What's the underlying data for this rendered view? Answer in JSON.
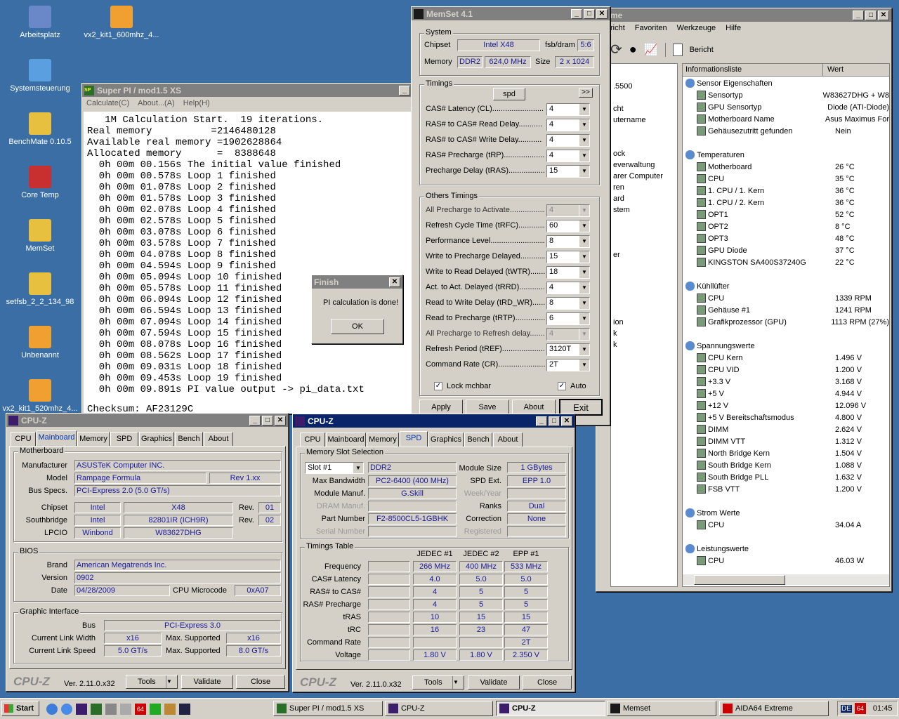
{
  "desktop": {
    "icons": [
      "Arbeitsplatz",
      "vx2_kit1_600mhz_4...",
      "Systemsteuerung",
      "BenchMate 0.10.5",
      "Core Temp",
      "MemSet",
      "setfsb_2_2_134_98",
      "Unbenannt",
      "vx2_kit1_520mhz_4..."
    ]
  },
  "aida": {
    "title_fragment": "me",
    "menu": [
      "richt",
      "Favoriten",
      "Werkzeuge",
      "Hilfe"
    ],
    "toolbar_report": "Bericht",
    "col_info": "Informationsliste",
    "col_value": "Wert",
    "tree_fragments": [
      ".5500",
      "cht",
      "utername",
      "ock",
      "everwaltung",
      "arer Computer",
      "ren",
      "ard",
      "stem",
      "er",
      "ion",
      "k",
      "k"
    ],
    "sections": [
      {
        "title": "Sensor Eigenschaften",
        "rows": [
          [
            "Sensortyp",
            "W83627DHG + W8"
          ],
          [
            "GPU Sensortyp",
            "Diode  (ATI-Diode)"
          ],
          [
            "Motherboard Name",
            "Asus Maximus For"
          ],
          [
            "Gehäusezutritt gefunden",
            "Nein"
          ]
        ]
      },
      {
        "title": "Temperaturen",
        "rows": [
          [
            "Motherboard",
            "26 °C"
          ],
          [
            "CPU",
            "35 °C"
          ],
          [
            "1. CPU / 1. Kern",
            "36 °C"
          ],
          [
            "1. CPU / 2. Kern",
            "36 °C"
          ],
          [
            "OPT1",
            "52 °C"
          ],
          [
            "OPT2",
            "8 °C"
          ],
          [
            "OPT3",
            "48 °C"
          ],
          [
            "GPU Diode",
            "37 °C"
          ],
          [
            "KINGSTON SA400S37240G",
            "22 °C"
          ]
        ]
      },
      {
        "title": "Kühllüfter",
        "rows": [
          [
            "CPU",
            "1339 RPM"
          ],
          [
            "Gehäuse #1",
            "1241 RPM"
          ],
          [
            "Grafikprozessor (GPU)",
            "1113 RPM  (27%)"
          ]
        ]
      },
      {
        "title": "Spannungswerte",
        "rows": [
          [
            "CPU Kern",
            "1.496 V"
          ],
          [
            "CPU VID",
            "1.200 V"
          ],
          [
            "+3.3 V",
            "3.168 V"
          ],
          [
            "+5 V",
            "4.944 V"
          ],
          [
            "+12 V",
            "12.096 V"
          ],
          [
            "+5 V Bereitschaftsmodus",
            "4.800 V"
          ],
          [
            "DIMM",
            "2.624 V"
          ],
          [
            "DIMM VTT",
            "1.312 V"
          ],
          [
            "North Bridge Kern",
            "1.504 V"
          ],
          [
            "South Bridge Kern",
            "1.088 V"
          ],
          [
            "South Bridge PLL",
            "1.632 V"
          ],
          [
            "FSB VTT",
            "1.200 V"
          ]
        ]
      },
      {
        "title": "Strom Werte",
        "rows": [
          [
            "CPU",
            "34.04 A"
          ]
        ]
      },
      {
        "title": "Leistungswerte",
        "rows": [
          [
            "CPU",
            "46.03 W"
          ]
        ]
      }
    ]
  },
  "memset": {
    "title": "MemSet 4.1",
    "system": "System",
    "chipset_l": "Chipset",
    "chipset": "Intel  X48",
    "fsb_l": "fsb/dram",
    "fsb": "5:6",
    "memory_l": "Memory",
    "mem_type": "DDR2",
    "mem_freq": "624,0 MHz",
    "size_l": "Size",
    "size": "2 x 1024",
    "timings": "Timings",
    "spd": "spd",
    "more": ">>",
    "t_rows": [
      [
        "CAS# Latency (CL)........................",
        "4"
      ],
      [
        "RAS# to CAS# Read Delay...........",
        "4"
      ],
      [
        "RAS# to CAS# Write Delay...........",
        "4"
      ],
      [
        "RAS# Precharge (tRP)....................",
        "4"
      ],
      [
        "Precharge Delay  (tRAS)...................",
        "15"
      ]
    ],
    "others": "Others Timings",
    "o_rows": [
      [
        "All Precharge to Activate...................",
        "4"
      ],
      [
        "Refresh Cycle Time (tRFC)...............",
        "60"
      ],
      [
        "Performance Level.............................",
        "8"
      ],
      [
        "Write to Precharge Delayed...............",
        "15"
      ],
      [
        "Write to Read Delayed (tWTR)...........",
        "18"
      ],
      [
        "Act. to Act. Delayed (tRRD)...............",
        "4"
      ],
      [
        "Read to Write Delay (tRD_WR)..........",
        "8"
      ],
      [
        "Read to Precharge (tRTP)................",
        "6"
      ],
      [
        "All Precharge to Refresh delay..........",
        "4"
      ],
      [
        "Refresh Period (tREF)........................",
        "3120T"
      ],
      [
        "Command Rate (CR)...........................",
        "2T"
      ]
    ],
    "lock": "Lock mchbar",
    "auto": "Auto",
    "apply": "Apply",
    "save": "Save",
    "about": "About",
    "exit": "Exit"
  },
  "superpi": {
    "title": "Super PI / mod1.5 XS",
    "menu": [
      "Calculate(C)",
      "About...(A)",
      "Help(H)"
    ],
    "lines": [
      "   1M Calculation Start.  19 iterations.",
      "Real memory          =2146480128",
      "Available real memory =1902628864",
      "Allocated memory      =  8388648",
      "  0h 00m 00.156s The initial value finished",
      "  0h 00m 00.578s Loop 1 finished",
      "  0h 00m 01.078s Loop 2 finished",
      "  0h 00m 01.578s Loop 3 finished",
      "  0h 00m 02.078s Loop 4 finished",
      "  0h 00m 02.578s Loop 5 finished",
      "  0h 00m 03.078s Loop 6 finished",
      "  0h 00m 03.578s Loop 7 finished",
      "  0h 00m 04.078s Loop 8 finished",
      "  0h 00m 04.594s Loop 9 finished",
      "  0h 00m 05.094s Loop 10 finished",
      "  0h 00m 05.578s Loop 11 finished",
      "  0h 00m 06.094s Loop 12 finished",
      "  0h 00m 06.594s Loop 13 finished",
      "  0h 00m 07.094s Loop 14 finished",
      "  0h 00m 07.594s Loop 15 finished",
      "  0h 00m 08.078s Loop 16 finished",
      "  0h 00m 08.562s Loop 17 finished",
      "  0h 00m 09.031s Loop 18 finished",
      "  0h 00m 09.453s Loop 19 finished",
      "  0h 00m 09.891s PI value output -> pi_data.txt"
    ],
    "checksum": "Checksum: AF23129C"
  },
  "finish": {
    "title": "Finish",
    "msg": "PI calculation is done!",
    "ok": "OK"
  },
  "cpuz1": {
    "title": "CPU-Z",
    "tabs": [
      "CPU",
      "Mainboard",
      "Memory",
      "SPD",
      "Graphics",
      "Bench",
      "About"
    ],
    "active": "Mainboard",
    "motherboard": "Motherboard",
    "manufacturer_l": "Manufacturer",
    "manufacturer": "ASUSTeK Computer INC.",
    "model_l": "Model",
    "model": "Rampage Formula",
    "rev": "Rev 1.xx",
    "bus_l": "Bus Specs.",
    "bus": "PCI-Express 2.0 (5.0 GT/s)",
    "chipset_l": "Chipset",
    "chipset_v": "Intel",
    "chipset_m": "X48",
    "rev_l": "Rev.",
    "chipset_rev": "01",
    "sb_l": "Southbridge",
    "sb_v": "Intel",
    "sb_m": "82801IR (ICH9R)",
    "sb_rev": "02",
    "lpcio_l": "LPCIO",
    "lpcio_v": "Winbond",
    "lpcio_m": "W83627DHG",
    "bios": "BIOS",
    "brand_l": "Brand",
    "brand": "American Megatrends Inc.",
    "version_l": "Version",
    "version": "0902",
    "date_l": "Date",
    "date": "04/28/2009",
    "micro_l": "CPU Microcode",
    "micro": "0xA07",
    "gi": "Graphic Interface",
    "gbus_l": "Bus",
    "gbus": "PCI-Express 3.0",
    "clw_l": "Current Link Width",
    "clw": "x16",
    "ms_l": "Max. Supported",
    "mlw": "x16",
    "cls_l": "Current Link Speed",
    "cls": "5.0 GT/s",
    "mls": "8.0 GT/s",
    "brand_logo": "CPU-Z",
    "ver": "Ver. 2.11.0.x32",
    "tools": "Tools",
    "validate": "Validate",
    "close": "Close"
  },
  "cpuz2": {
    "title": "CPU-Z",
    "tabs": [
      "CPU",
      "Mainboard",
      "Memory",
      "SPD",
      "Graphics",
      "Bench",
      "About"
    ],
    "active": "SPD",
    "mss": "Memory Slot Selection",
    "slot": "Slot #1",
    "type": "DDR2",
    "modsize_l": "Module Size",
    "modsize": "1 GBytes",
    "maxbw_l": "Max Bandwidth",
    "maxbw": "PC2-6400 (400 MHz)",
    "spdext_l": "SPD Ext.",
    "spdext": "EPP 1.0",
    "modman_l": "Module Manuf.",
    "modman": "G.Skill",
    "week_l": "Week/Year",
    "dram_l": "DRAM Manuf.",
    "ranks_l": "Ranks",
    "ranks": "Dual",
    "part_l": "Part Number",
    "part": "F2-8500CL5-1GBHK",
    "corr_l": "Correction",
    "corr": "None",
    "serial_l": "Serial Number",
    "reg_l": "Registered",
    "tt": "Timings Table",
    "cols": [
      "JEDEC #1",
      "JEDEC #2",
      "EPP #1"
    ],
    "rows": [
      [
        "Frequency",
        "266 MHz",
        "400 MHz",
        "533 MHz"
      ],
      [
        "CAS# Latency",
        "4.0",
        "5.0",
        "5.0"
      ],
      [
        "RAS# to CAS#",
        "4",
        "5",
        "5"
      ],
      [
        "RAS# Precharge",
        "4",
        "5",
        "5"
      ],
      [
        "tRAS",
        "10",
        "15",
        "15"
      ],
      [
        "tRC",
        "16",
        "23",
        "47"
      ],
      [
        "Command Rate",
        "",
        "",
        "2T"
      ],
      [
        "Voltage",
        "1.80 V",
        "1.80 V",
        "2.350 V"
      ]
    ],
    "brand_logo": "CPU-Z",
    "ver": "Ver. 2.11.0.x32",
    "tools": "Tools",
    "validate": "Validate",
    "close": "Close"
  },
  "taskbar": {
    "start": "Start",
    "tasks": [
      "Super PI / mod1.5 XS",
      "CPU-Z",
      "CPU-Z",
      "Memset",
      "AIDA64 Extreme"
    ],
    "lang": "DE",
    "time": "01:45"
  }
}
